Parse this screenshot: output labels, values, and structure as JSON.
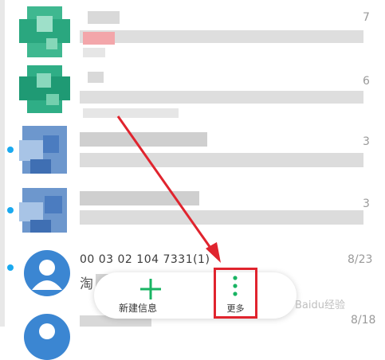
{
  "conversations": [
    {
      "time": "7",
      "unread": false
    },
    {
      "time": "6",
      "unread": false
    },
    {
      "time": "3",
      "unread": true
    },
    {
      "time": "3",
      "unread": true
    },
    {
      "time": "8/23",
      "unread": true,
      "sender": "00 03 02 104 7331(1)",
      "preview": "淘"
    },
    {
      "time": "8/18",
      "unread": false
    }
  ],
  "toolbar": {
    "new_message_label": "新建信息",
    "more_label": "更多"
  },
  "watermark": "Baidu经验",
  "colors": {
    "accent": "#19b463",
    "unread_dot": "#1aa9ef",
    "annotation_red": "#e0242e"
  }
}
